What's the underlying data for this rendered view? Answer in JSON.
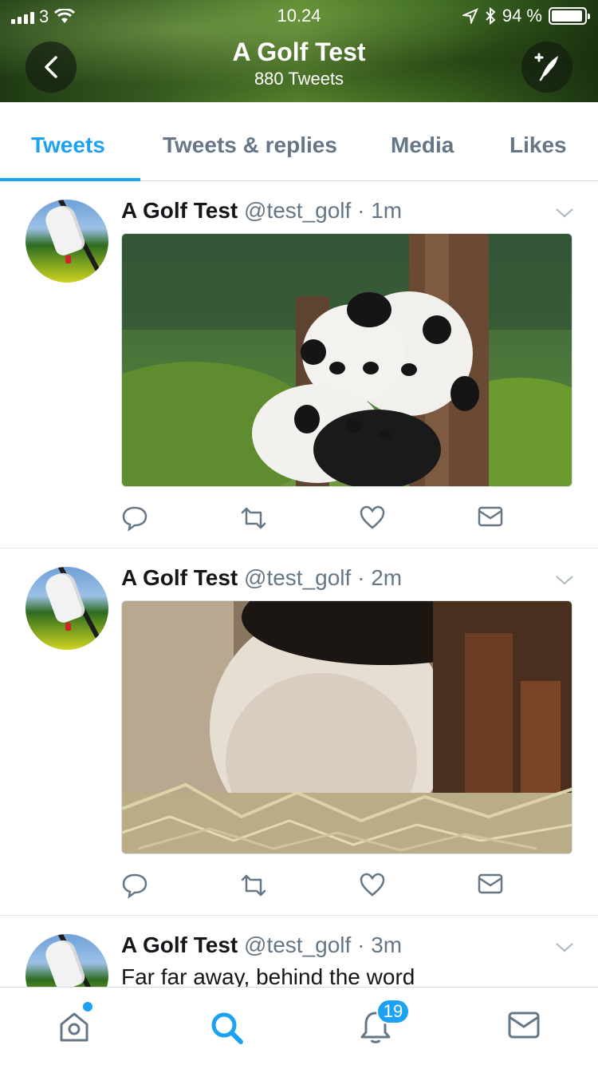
{
  "status_bar": {
    "carrier": "3",
    "time": "10.24",
    "battery_percent_label": "94 %",
    "battery_level": 0.94
  },
  "header": {
    "title": "A Golf Test",
    "subtitle": "880 Tweets",
    "back_icon": "chevron-left-icon",
    "compose_icon": "compose-feather-icon"
  },
  "tabs": [
    {
      "label": "Tweets",
      "active": true
    },
    {
      "label": "Tweets & replies",
      "active": false
    },
    {
      "label": "Media",
      "active": false
    },
    {
      "label": "Likes",
      "active": false
    }
  ],
  "tweets": [
    {
      "name": "A Golf Test",
      "handle": "@test_golf",
      "time": "1m",
      "media": "pandas-photo"
    },
    {
      "name": "A Golf Test",
      "handle": "@test_golf",
      "time": "2m",
      "media": "panda-closeup-photo"
    },
    {
      "name": "A Golf Test",
      "handle": "@test_golf",
      "time": "3m",
      "text": "Far far away, behind the word"
    }
  ],
  "tabbar": {
    "items": [
      "home-icon",
      "search-icon",
      "notifications-icon",
      "messages-icon"
    ],
    "notification_count": "19",
    "accent": "#1da1f2"
  }
}
